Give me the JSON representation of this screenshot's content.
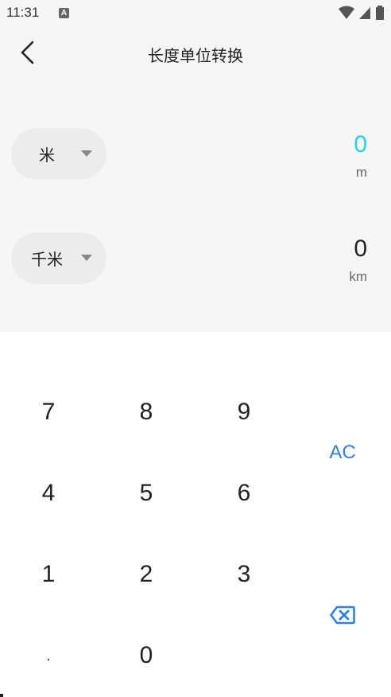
{
  "status_bar": {
    "time": "11:31",
    "notification_icon": "A"
  },
  "header": {
    "title": "长度单位转换",
    "back_icon": "chevron-left-icon"
  },
  "converter": {
    "from": {
      "unit_label": "米",
      "value": "0",
      "symbol": "m"
    },
    "to": {
      "unit_label": "千米",
      "value": "0",
      "symbol": "km"
    }
  },
  "keypad": {
    "k7": "7",
    "k8": "8",
    "k9": "9",
    "k4": "4",
    "k5": "5",
    "k6": "6",
    "k1": "1",
    "k2": "2",
    "k3": "3",
    "kdot": ".",
    "k0": "0",
    "clear": "AC",
    "delete_icon": "backspace-icon"
  },
  "colors": {
    "accent": "#2f80ed",
    "active_value": "#1fd4f0",
    "panel_bg": "#f7f6f5",
    "pill_bg": "#ececec"
  }
}
